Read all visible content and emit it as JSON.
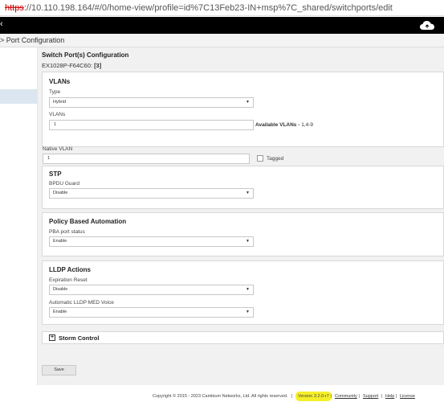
{
  "browser": {
    "url_protocol": "https",
    "url_rest": "://10.110.198.164/#/0/home-view/profile=id%7C13Feb23-IN+msp%7C_shared/switchports/edit"
  },
  "topbar": {
    "left_glyph": "‹",
    "cloud_icon": "cloud-icon"
  },
  "breadcrumb": {
    "text": "> Port Configuration"
  },
  "page": {
    "title": "Switch Port(s) Configuration",
    "device_name": "EX1028P-F64C60:",
    "port_count": "[3]"
  },
  "vlans": {
    "title": "VLANs",
    "type_label": "Type",
    "type_value": "Hybrid",
    "vlans_label": "VLANs",
    "vlans_value": "1",
    "available_label": "Available VLANs -",
    "available_value": "1,4-9"
  },
  "native_vlan": {
    "label": "Native VLAN",
    "value": "1",
    "tagged_label": "Tagged"
  },
  "stp": {
    "title": "STP",
    "bpdu_label": "BPDU Guard",
    "bpdu_value": "Disable"
  },
  "pba": {
    "title": "Policy Based Automation",
    "status_label": "PBA port status",
    "status_value": "Enable"
  },
  "lldp": {
    "title": "LLDP Actions",
    "expiration_label": "Expiration Reset",
    "expiration_value": "Disable",
    "med_label": "Automatic LLDP MED Voice",
    "med_value": "Enable"
  },
  "storm": {
    "title": "Storm Control"
  },
  "actions": {
    "save_label": "Save"
  },
  "footer": {
    "copyright": "Copyright © 2015 - 2023 Cambium Networks, Ltd. All rights reserved.",
    "version": "Version 3.2.0-r7",
    "community": "Community",
    "support": "Support",
    "help": "Help",
    "license": "License",
    "sep": "|"
  }
}
